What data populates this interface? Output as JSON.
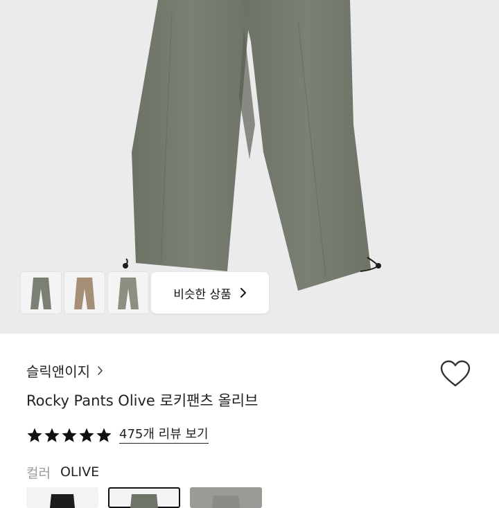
{
  "hero": {
    "image": "olive-pants-photo",
    "background": "#ebebec",
    "thumbnails": [
      {
        "icon": "olive-pants-thumbnail",
        "color": "#7a8073"
      },
      {
        "icon": "beige-pants-thumbnail",
        "color": "#a58f76"
      },
      {
        "icon": "sage-pants-thumbnail",
        "color": "#8b9080"
      }
    ],
    "similar_button_label": "비슷한 상품",
    "similar_button_icon": "chevron-right-icon"
  },
  "product": {
    "brand": "슬릭앤이지",
    "brand_icon": "chevron-right-icon",
    "title": "Rocky Pants Olive 로키팬츠 올리브",
    "wishlist_icon": "heart-outline-icon",
    "rating": 5,
    "rating_max": 5,
    "review_link": "475개 리뷰 보기"
  },
  "options": {
    "color_label": "컬러",
    "color_value": "OLIVE",
    "swatches": [
      {
        "name": "black",
        "color": "#1d1d1d",
        "selected": false
      },
      {
        "name": "olive",
        "color": "#6f7468",
        "selected": true
      },
      {
        "name": "grey",
        "color": "#9a9a96",
        "selected": false
      }
    ]
  }
}
